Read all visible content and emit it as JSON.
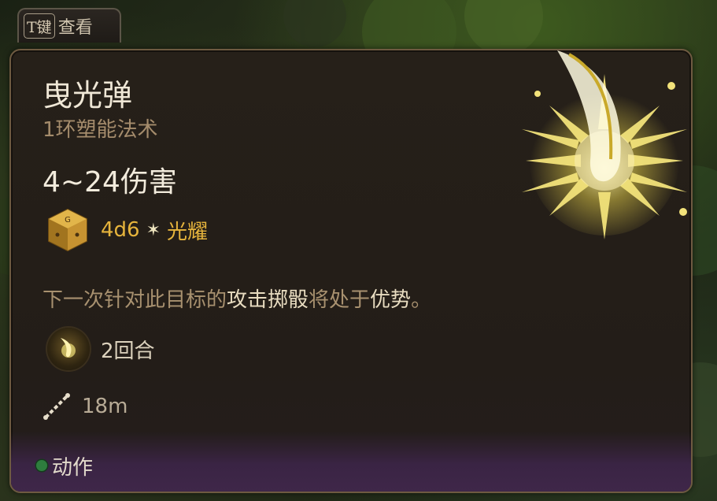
{
  "hint": {
    "key": "T键",
    "label": "查看"
  },
  "spell": {
    "name": "曳光弹",
    "level_school": "1环塑能法术",
    "damage": "4~24伤害",
    "dice": "4d6",
    "damage_type": "光耀",
    "description": {
      "part1": "下一次针对此目标的",
      "highlight1": "攻击掷骰",
      "part2": "将处于",
      "highlight2": "优势",
      "part3": "。"
    },
    "duration": "2回合",
    "range": "18m",
    "action": "动作"
  },
  "colors": {
    "accent_gold": "#e6b43c",
    "action_green": "#2e7d3e",
    "footer_purple": "#3f2749",
    "border": "#6e5a41"
  },
  "icons": {
    "spell_art": "guiding-bolt-sun-icon",
    "dice": "d6-dice-icon",
    "damage_type": "radiant-sparkle-icon",
    "duration": "guiding-bolt-duration-icon",
    "range": "range-ruler-icon",
    "action": "action-dot-icon"
  }
}
